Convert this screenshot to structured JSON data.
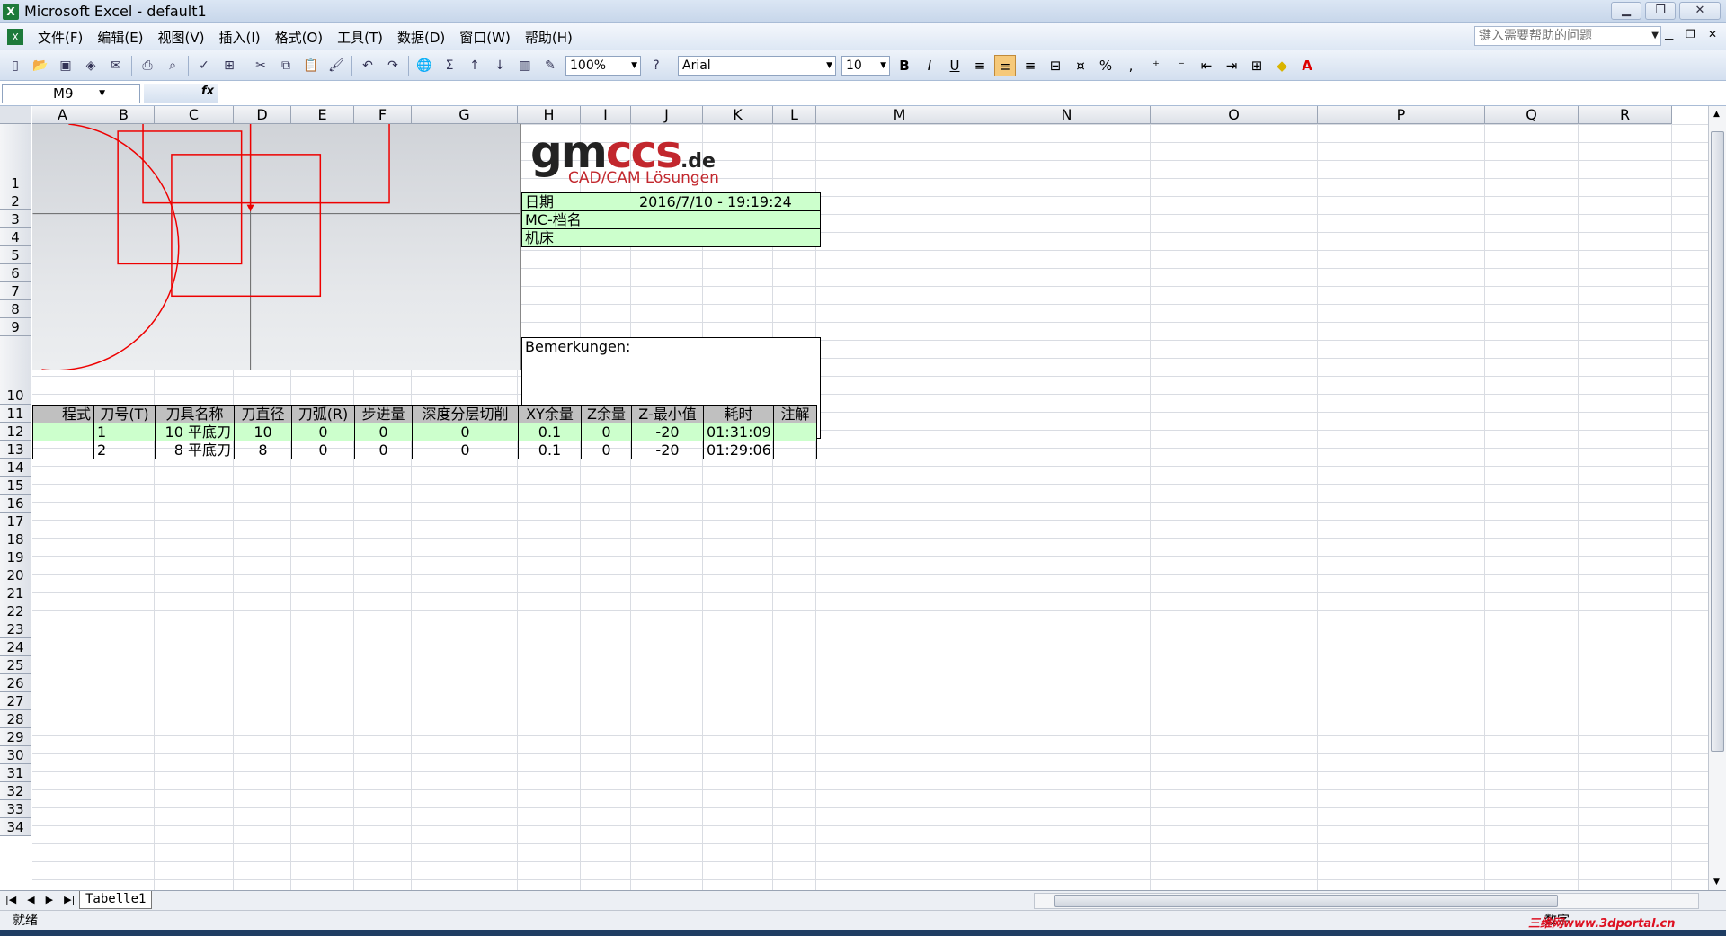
{
  "window": {
    "title": "Microsoft Excel - default1"
  },
  "menu": [
    "文件(F)",
    "编辑(E)",
    "视图(V)",
    "插入(I)",
    "格式(O)",
    "工具(T)",
    "数据(D)",
    "窗口(W)",
    "帮助(H)"
  ],
  "help": {
    "placeholder": "键入需要帮助的问题"
  },
  "toolbar": {
    "zoom": "100%",
    "font": "Arial",
    "size": "10"
  },
  "formula": {
    "namebox": "M9",
    "fx": "fx"
  },
  "columns": [
    "A",
    "B",
    "C",
    "D",
    "E",
    "F",
    "G",
    "H",
    "I",
    "J",
    "K",
    "L",
    "M",
    "N",
    "O",
    "P",
    "Q",
    "R"
  ],
  "rows": [
    "1",
    "2",
    "3",
    "4",
    "5",
    "6",
    "7",
    "8",
    "9",
    "10",
    "11",
    "12",
    "13",
    "14",
    "15",
    "16",
    "17",
    "18",
    "19",
    "20",
    "21",
    "22",
    "23",
    "24",
    "25",
    "26",
    "27",
    "28",
    "29",
    "30",
    "31",
    "32",
    "33",
    "34"
  ],
  "logo": {
    "part1": "gm",
    "part2": "ccs",
    "tld": ".de",
    "tagline": "CAD/CAM Lösungen"
  },
  "info": {
    "date_label": "日期",
    "date_value": "2016/7/10 - 19:19:24",
    "mc_label": "MC-档名",
    "machine_label": "机床",
    "remarks_label": "Bemerkungen:"
  },
  "table": {
    "headers": [
      "程式",
      "刀号(T)",
      "刀具名称",
      "刀直径",
      "刀弧(R)",
      "步进量",
      "深度分层切削",
      "XY余量",
      "Z余量",
      "Z-最小值",
      "耗时",
      "注解"
    ],
    "rows": [
      [
        "",
        "1",
        "10 平底刀",
        "10",
        "0",
        "0",
        "0",
        "0.1",
        "0",
        "-20",
        "01:31:09",
        ""
      ],
      [
        "",
        "2",
        "8 平底刀",
        "8",
        "0",
        "0",
        "0",
        "0.1",
        "0",
        "-20",
        "01:29:06",
        ""
      ]
    ]
  },
  "sheet": {
    "tab": "Tabelle1"
  },
  "status": {
    "ready": "就绪",
    "num": "数字"
  },
  "watermark": "三维网www.3dportal.cn"
}
